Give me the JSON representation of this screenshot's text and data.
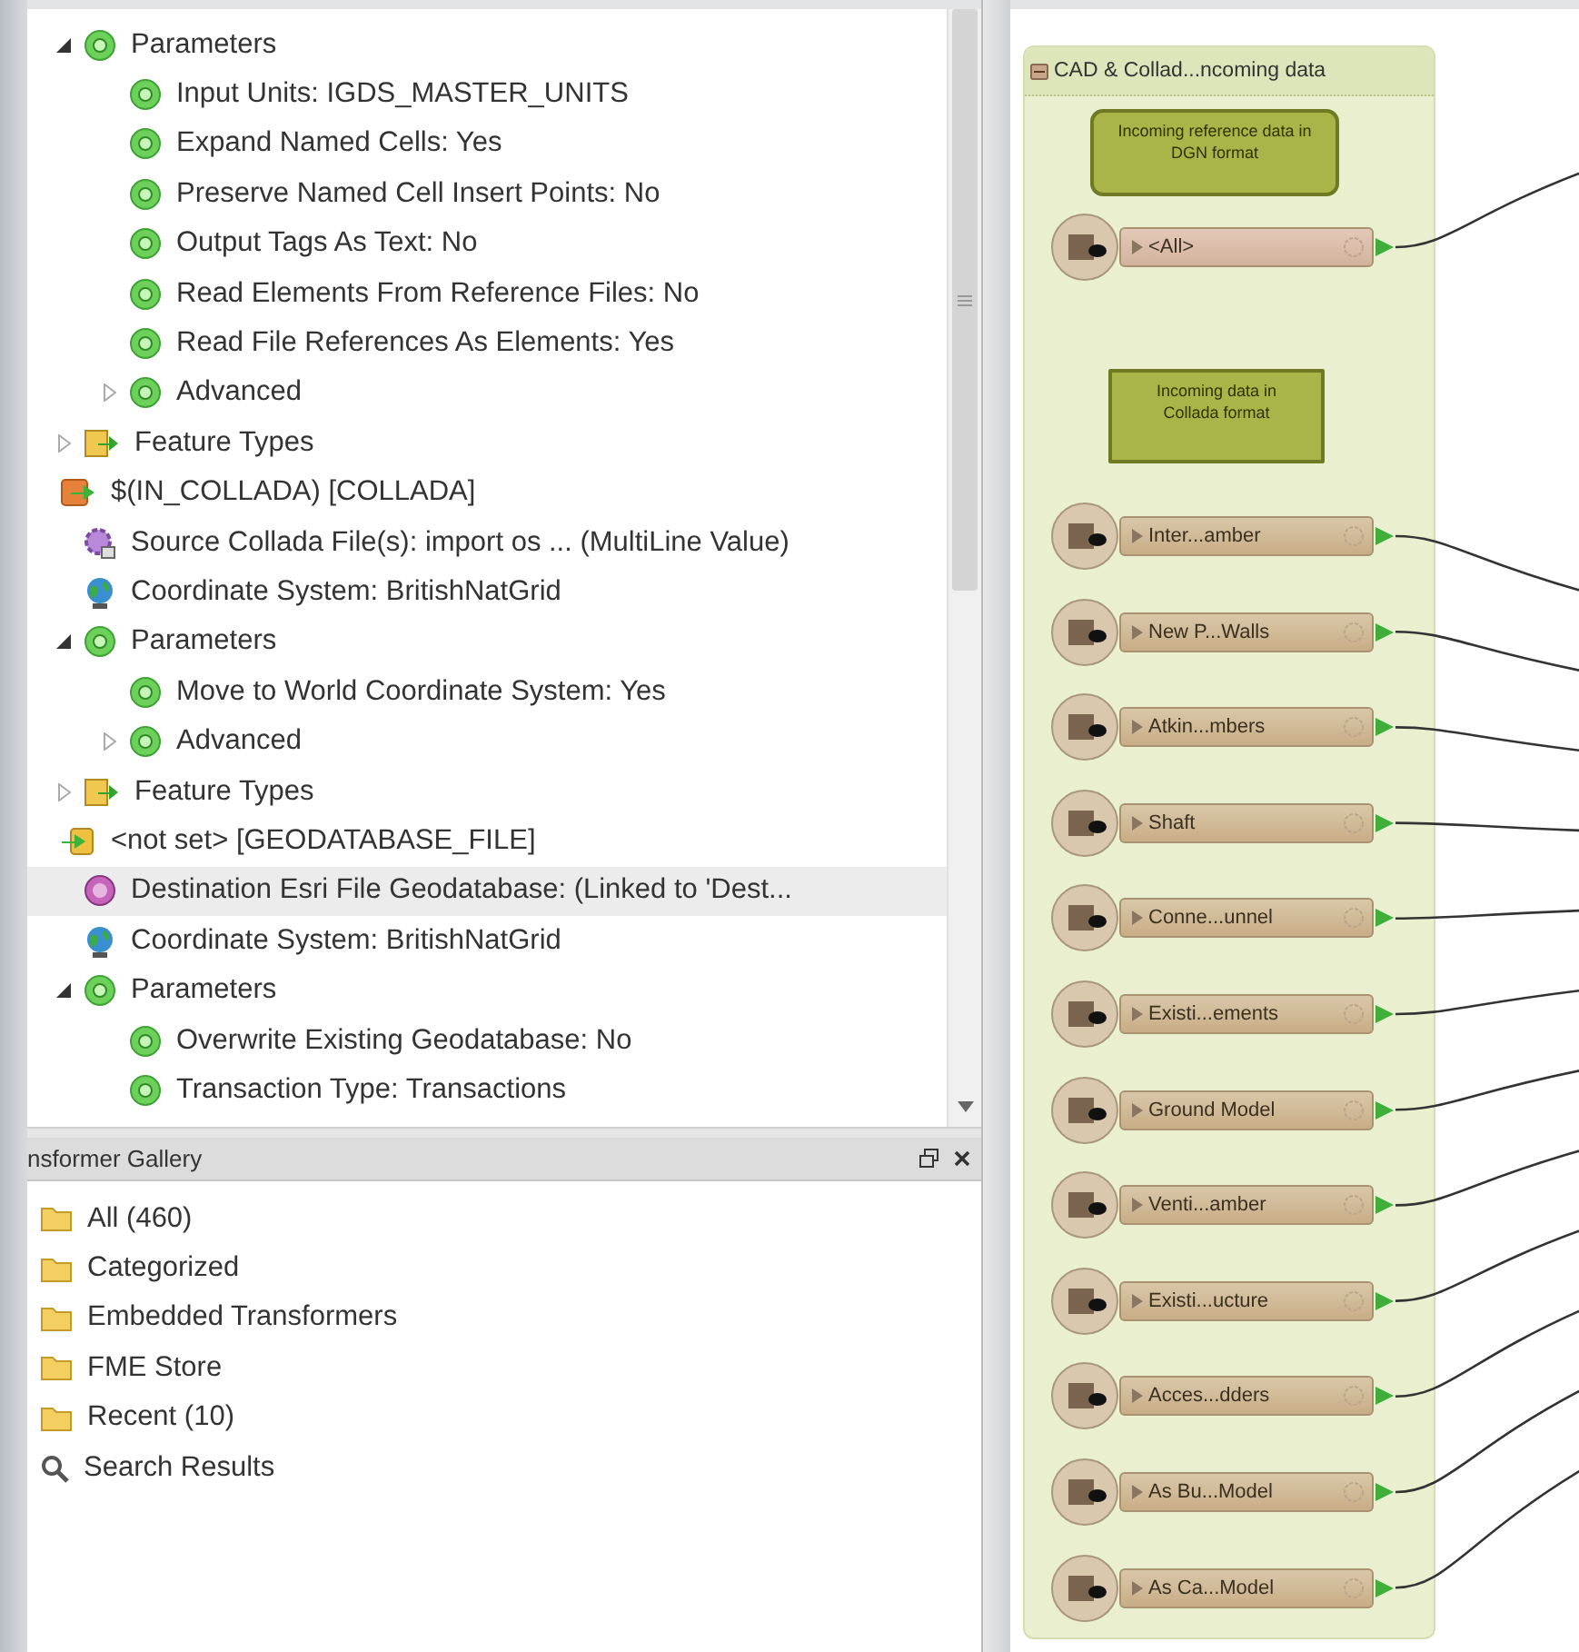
{
  "navigator": {
    "tree": [
      {
        "children": [
          {
            "label": "Parameters",
            "kind": "gear",
            "expanded": true,
            "selected": false,
            "children": [
              {
                "label": "Input Units: IGDS_MASTER_UNITS",
                "kind": "gear",
                "selected": false
              },
              {
                "label": "Expand Named Cells: Yes",
                "kind": "gear",
                "selected": false
              },
              {
                "label": "Preserve Named Cell Insert Points: No",
                "kind": "gear",
                "selected": false
              },
              {
                "label": "Output Tags As Text: No",
                "kind": "gear",
                "selected": false
              },
              {
                "label": "Read Elements From Reference Files: No",
                "kind": "gear",
                "selected": false
              },
              {
                "label": "Read File References As Elements: Yes",
                "kind": "gear",
                "selected": false
              },
              {
                "label": "Advanced",
                "kind": "gear",
                "expanded": false,
                "selected": false
              }
            ]
          },
          {
            "label": "Feature Types",
            "kind": "feature-types",
            "expanded": false,
            "selected": false
          }
        ]
      },
      {
        "label": "$(IN_COLLADA) [COLLADA]",
        "kind": "reader",
        "selected": false,
        "children": [
          {
            "label": "Source Collada File(s): import os ... (MultiLine Value)",
            "kind": "source",
            "selected": false
          },
          {
            "label": "Coordinate System: BritishNatGrid",
            "kind": "globe",
            "selected": false
          },
          {
            "label": "Parameters",
            "kind": "gear",
            "expanded": true,
            "selected": false,
            "children": [
              {
                "label": "Move to World Coordinate System: Yes",
                "kind": "gear",
                "selected": false
              },
              {
                "label": "Advanced",
                "kind": "gear",
                "expanded": false,
                "selected": false
              }
            ]
          },
          {
            "label": "Feature Types",
            "kind": "feature-types",
            "expanded": false,
            "selected": false
          }
        ]
      },
      {
        "label": "<not set> [GEODATABASE_FILE]",
        "kind": "writer",
        "selected": false,
        "children": [
          {
            "label": "Destination Esri File Geodatabase: (Linked to 'Dest...",
            "kind": "dataset",
            "selected": true
          },
          {
            "label": "Coordinate System: BritishNatGrid",
            "kind": "globe",
            "selected": false
          },
          {
            "label": "Parameters",
            "kind": "gear",
            "expanded": true,
            "selected": false,
            "children": [
              {
                "label": "Overwrite Existing Geodatabase: No",
                "kind": "gear",
                "selected": false
              },
              {
                "label": "Transaction Type: Transactions",
                "kind": "gear",
                "selected": false
              }
            ]
          }
        ]
      }
    ]
  },
  "gallery": {
    "title": "nsformer Gallery",
    "items": [
      {
        "label": "All (460)",
        "kind": "folder"
      },
      {
        "label": "Categorized",
        "kind": "folder"
      },
      {
        "label": "Embedded Transformers",
        "kind": "folder"
      },
      {
        "label": "FME Store",
        "kind": "folder"
      },
      {
        "label": "Recent (10)",
        "kind": "folder"
      },
      {
        "label": "Search Results",
        "kind": "search"
      }
    ]
  },
  "canvas": {
    "bookmark": {
      "title": "CAD & Collad...ncoming data",
      "notes": [
        {
          "text": "Incoming reference data in DGN format",
          "kind": "callout"
        },
        {
          "text": "Incoming data in Collada format",
          "kind": "box"
        }
      ],
      "features": [
        "<All>",
        "Inter...amber",
        "New P...Walls",
        "Atkin...mbers",
        "Shaft",
        "Conne...unnel",
        "Existi...ements",
        "Ground Model",
        "Venti...amber",
        "Existi...ucture",
        "Acces...dders",
        "As Bu...Model",
        "As Ca...Model"
      ]
    }
  }
}
